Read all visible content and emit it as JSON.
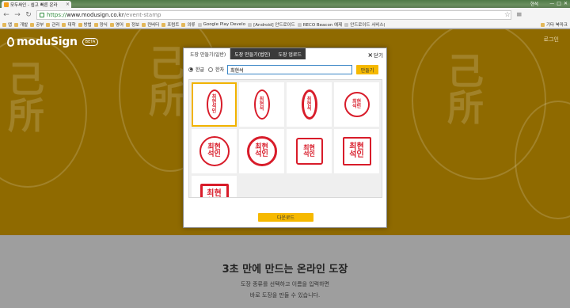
{
  "browser": {
    "tab_title": "모두싸인 - 쉽고 빠른 온라",
    "user_label": "현석",
    "window_buttons": [
      "—",
      "□",
      "✕"
    ],
    "url_https": "https://",
    "url_domain": "www.modusign.co.kr",
    "url_path": "/event-stamp",
    "bookmarks": [
      {
        "label": "앱",
        "kind": "apps"
      },
      {
        "label": "개발",
        "kind": "folder"
      },
      {
        "label": "공부",
        "kind": "folder"
      },
      {
        "label": "관리",
        "kind": "folder"
      },
      {
        "label": "대학",
        "kind": "folder"
      },
      {
        "label": "방법",
        "kind": "folder"
      },
      {
        "label": "양식",
        "kind": "folder"
      },
      {
        "label": "영어",
        "kind": "folder"
      },
      {
        "label": "정보",
        "kind": "folder"
      },
      {
        "label": "컨버터",
        "kind": "folder"
      },
      {
        "label": "포럼트",
        "kind": "folder"
      },
      {
        "label": "의류",
        "kind": "folder"
      },
      {
        "label": "Google Play Develo",
        "kind": "page"
      },
      {
        "label": "[Android] 안드로이드",
        "kind": "page"
      },
      {
        "label": "RECO Beacon 예제",
        "kind": "page"
      },
      {
        "label": "안드로이드 서비스(",
        "kind": "page"
      }
    ],
    "other_bookmarks": "기타 북마크"
  },
  "site": {
    "logo_text": "moduSign",
    "beta_badge": "BETA",
    "login_link": "로그인",
    "headline": "3초 만에 만드는 온라인 도장",
    "sub_line1": "도장 종류를 선택하고 이름을 입력하면",
    "sub_line2": "바로 도장을 만들 수 있습니다."
  },
  "modal": {
    "tabs": [
      {
        "label": "도장 만들기(일반)",
        "active": true
      },
      {
        "label": "도장 만들기(법인)",
        "active": false
      },
      {
        "label": "도장 업로드",
        "active": false
      }
    ],
    "close_label": "닫기",
    "script_options": [
      {
        "label": "한글",
        "selected": true
      },
      {
        "label": "한자",
        "selected": false
      }
    ],
    "name_value": "최현석",
    "make_button": "만들기",
    "download_button": "다운로드",
    "stamps": [
      {
        "style": "oval-seal",
        "text": "최현석인",
        "selected": true
      },
      {
        "style": "oval-vertical",
        "text": "최현석",
        "selected": false
      },
      {
        "style": "oval-vertical-bold",
        "text": "최현석",
        "selected": false
      },
      {
        "style": "circle-seal",
        "text": "최현석인",
        "selected": false
      },
      {
        "style": "circle-2x2",
        "text": "최현석인",
        "selected": false
      },
      {
        "style": "circle-2x2-bold",
        "text": "최현석인",
        "selected": false
      },
      {
        "style": "square-seal",
        "text": "최현석인",
        "selected": false
      },
      {
        "style": "square-2x2",
        "text": "최현석인",
        "selected": false
      },
      {
        "style": "square-2x2-bold",
        "text": "최현석인",
        "selected": false
      }
    ]
  },
  "colors": {
    "accent": "#f6b900",
    "stamp_red": "#d81c2a",
    "hero_dim": "#8f6a00",
    "overlay_gray": "#9e9e9e"
  }
}
